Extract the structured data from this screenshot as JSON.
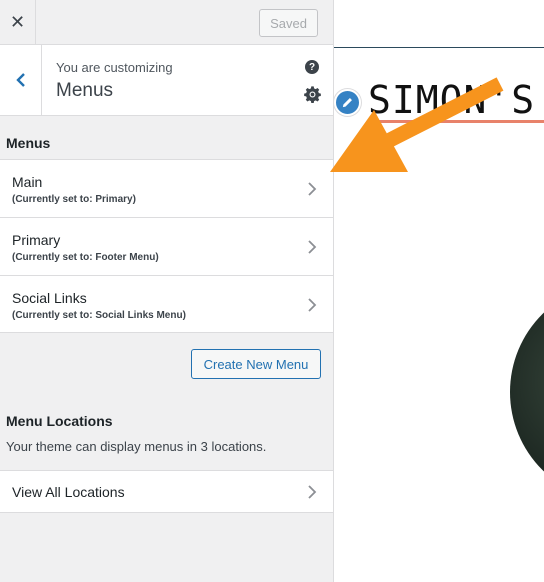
{
  "topbar": {
    "close_glyph": "✕",
    "saved_label": "Saved"
  },
  "section": {
    "customizing_label": "You are customizing",
    "title": "Menus",
    "help_glyph": "?"
  },
  "menus": {
    "heading": "Menus",
    "items": [
      {
        "name": "Main",
        "status": "(Currently set to: Primary)"
      },
      {
        "name": "Primary",
        "status": "(Currently set to: Footer Menu)"
      },
      {
        "name": "Social Links",
        "status": "(Currently set to: Social Links Menu)"
      }
    ],
    "create_label": "Create New Menu"
  },
  "locations": {
    "heading": "Menu Locations",
    "description": "Your theme can display menus in 3 locations.",
    "view_all_label": "View All Locations"
  },
  "preview": {
    "site_title": "SIMON'S"
  },
  "colors": {
    "accent": "#2271b1",
    "arrow": "#f7941d",
    "underline": "#e8826a"
  }
}
